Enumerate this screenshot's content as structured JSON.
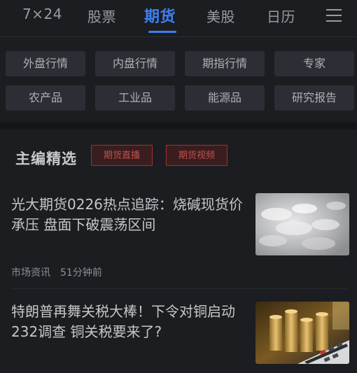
{
  "nav": {
    "tabs": [
      {
        "label": "7×24"
      },
      {
        "label": "股票"
      },
      {
        "label": "期货",
        "active": true
      },
      {
        "label": "美股"
      },
      {
        "label": "日历"
      }
    ],
    "menu_icon": "hamburger-menu-icon"
  },
  "categories": [
    "外盘行情",
    "内盘行情",
    "期指行情",
    "专家",
    "农产品",
    "工业品",
    "能源品",
    "研究报告"
  ],
  "picks": {
    "title": "主编精选",
    "tags": [
      "期货直播",
      "期货视频"
    ]
  },
  "news": [
    {
      "title": "光大期货0226热点追踪：烧碱现货价承压 盘面下破震荡区间",
      "source": "市场资讯",
      "time": "51分钟前",
      "thumb": "white-crystal-photo"
    },
    {
      "title": "特朗普再舞关税大棒！下令对铜启动232调查 铜关税要来了?",
      "thumb": "coins-calculator-photo"
    }
  ],
  "colors": {
    "accent": "#3d7ff0",
    "tag_red": "#c0504a",
    "background": "#1c1d21"
  }
}
